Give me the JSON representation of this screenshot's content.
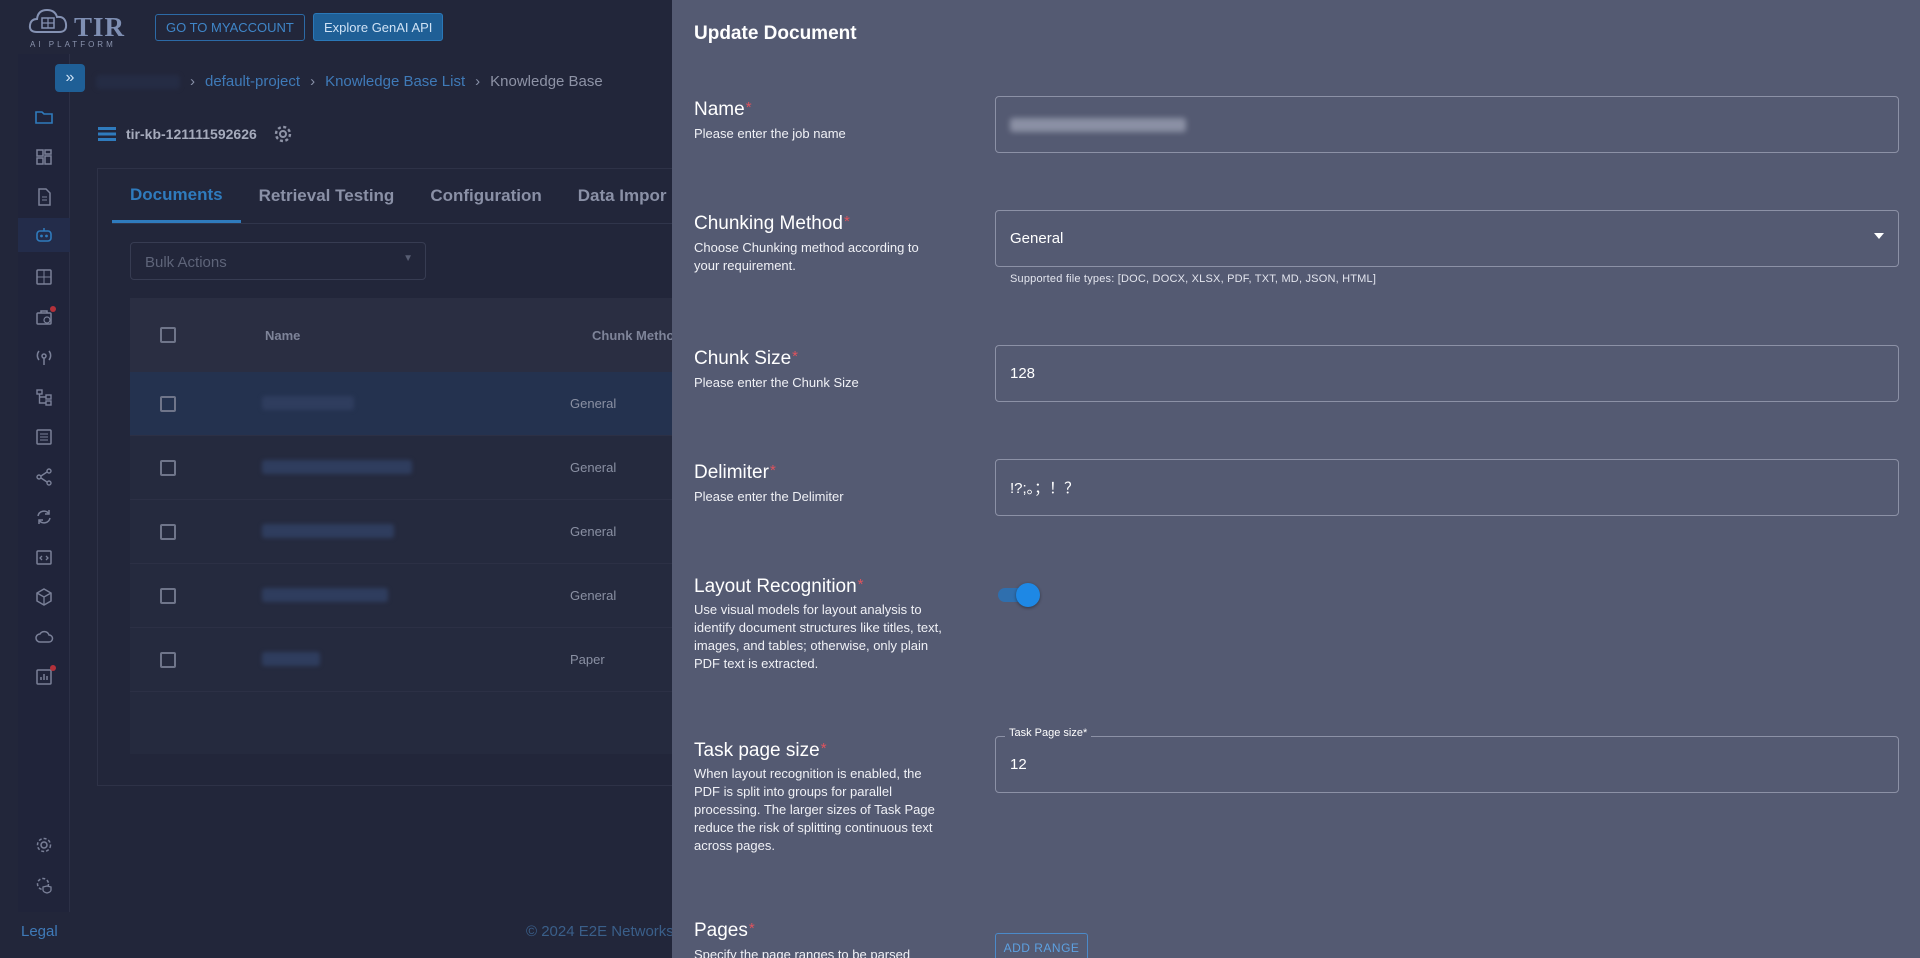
{
  "header": {
    "logo_text": "TIR",
    "logo_sub": "AI PLATFORM",
    "myaccount_button": "GO TO MYACCOUNT",
    "genai_button": "Explore GenAI API"
  },
  "breadcrumb": {
    "project": "default-project",
    "list": "Knowledge Base List",
    "current": "Knowledge Base"
  },
  "kb": {
    "name": "tir-kb-121111592626"
  },
  "tabs": [
    {
      "label": "Documents"
    },
    {
      "label": "Retrieval Testing"
    },
    {
      "label": "Configuration"
    },
    {
      "label": "Data Impor"
    }
  ],
  "bulk_actions": {
    "placeholder": "Bulk Actions"
  },
  "table": {
    "headers": {
      "name": "Name",
      "chunk_method": "Chunk Metho"
    },
    "rows": [
      {
        "chunk_method": "General"
      },
      {
        "chunk_method": "General"
      },
      {
        "chunk_method": "General"
      },
      {
        "chunk_method": "General"
      },
      {
        "chunk_method": "Paper"
      }
    ]
  },
  "footer": {
    "legal": "Legal",
    "copyright": "© 2024 E2E Networks"
  },
  "drawer": {
    "title": "Update Document",
    "name": {
      "label": "Name",
      "desc": "Please enter the job name"
    },
    "chunking": {
      "label": "Chunking Method",
      "desc": "Choose Chunking method according to your requirement.",
      "value": "General",
      "helper": "Supported file types: [DOC, DOCX, XLSX, PDF, TXT, MD, JSON, HTML]"
    },
    "chunk_size": {
      "label": "Chunk Size",
      "desc": "Please enter the Chunk Size",
      "value": "128"
    },
    "delimiter": {
      "label": "Delimiter",
      "desc": "Please enter the Delimiter",
      "value": "!?;。；！？"
    },
    "layout": {
      "label": "Layout Recognition",
      "desc": "Use visual models for layout analysis to identify document structures like titles, text, images, and tables; otherwise, only plain PDF text is extracted.",
      "enabled": true
    },
    "task_page": {
      "label": "Task page size",
      "desc": "When layout recognition is enabled, the PDF is split into groups for parallel processing. The larger sizes of Task Page reduce the risk of splitting continuous text across pages.",
      "float_label": "Task Page size",
      "value": "12"
    },
    "pages": {
      "label": "Pages",
      "desc": "Specify the page ranges to be parsed",
      "button": "ADD RANGE"
    }
  },
  "colors": {
    "accent": "#2f7bbd",
    "drawer_bg": "#545a72",
    "required": "#e0535d"
  }
}
